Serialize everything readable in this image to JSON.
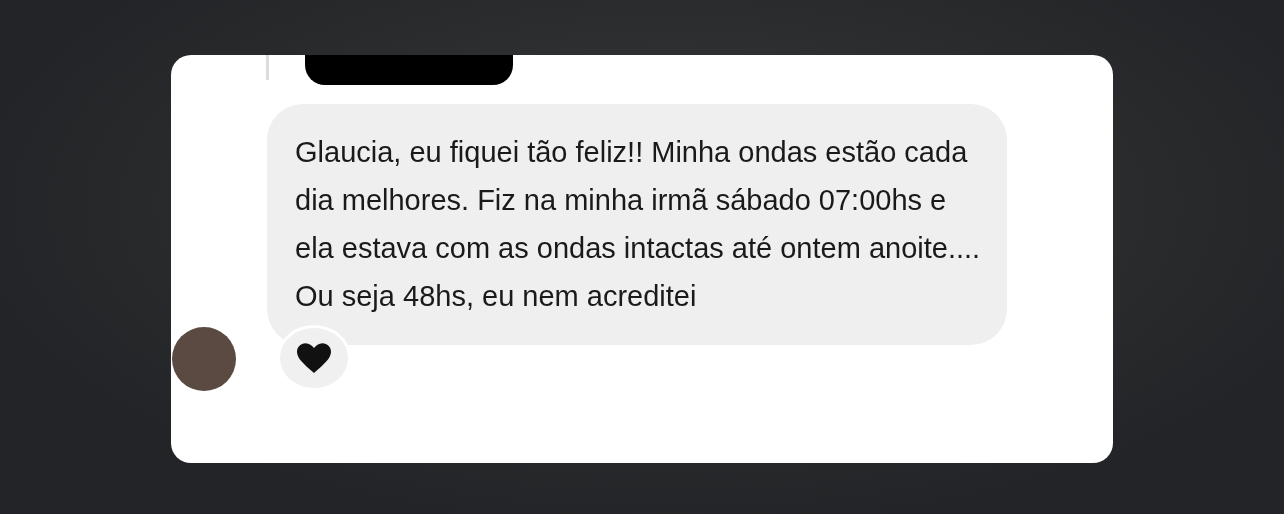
{
  "message": {
    "text": "Glaucia, eu fiquei tão feliz!! Minha ondas estão cada dia melhores. Fiz na minha irmã sábado 07:00hs e ela estava com as ondas intactas até ontem anoite.... Ou seja 48hs, eu nem acreditei"
  }
}
